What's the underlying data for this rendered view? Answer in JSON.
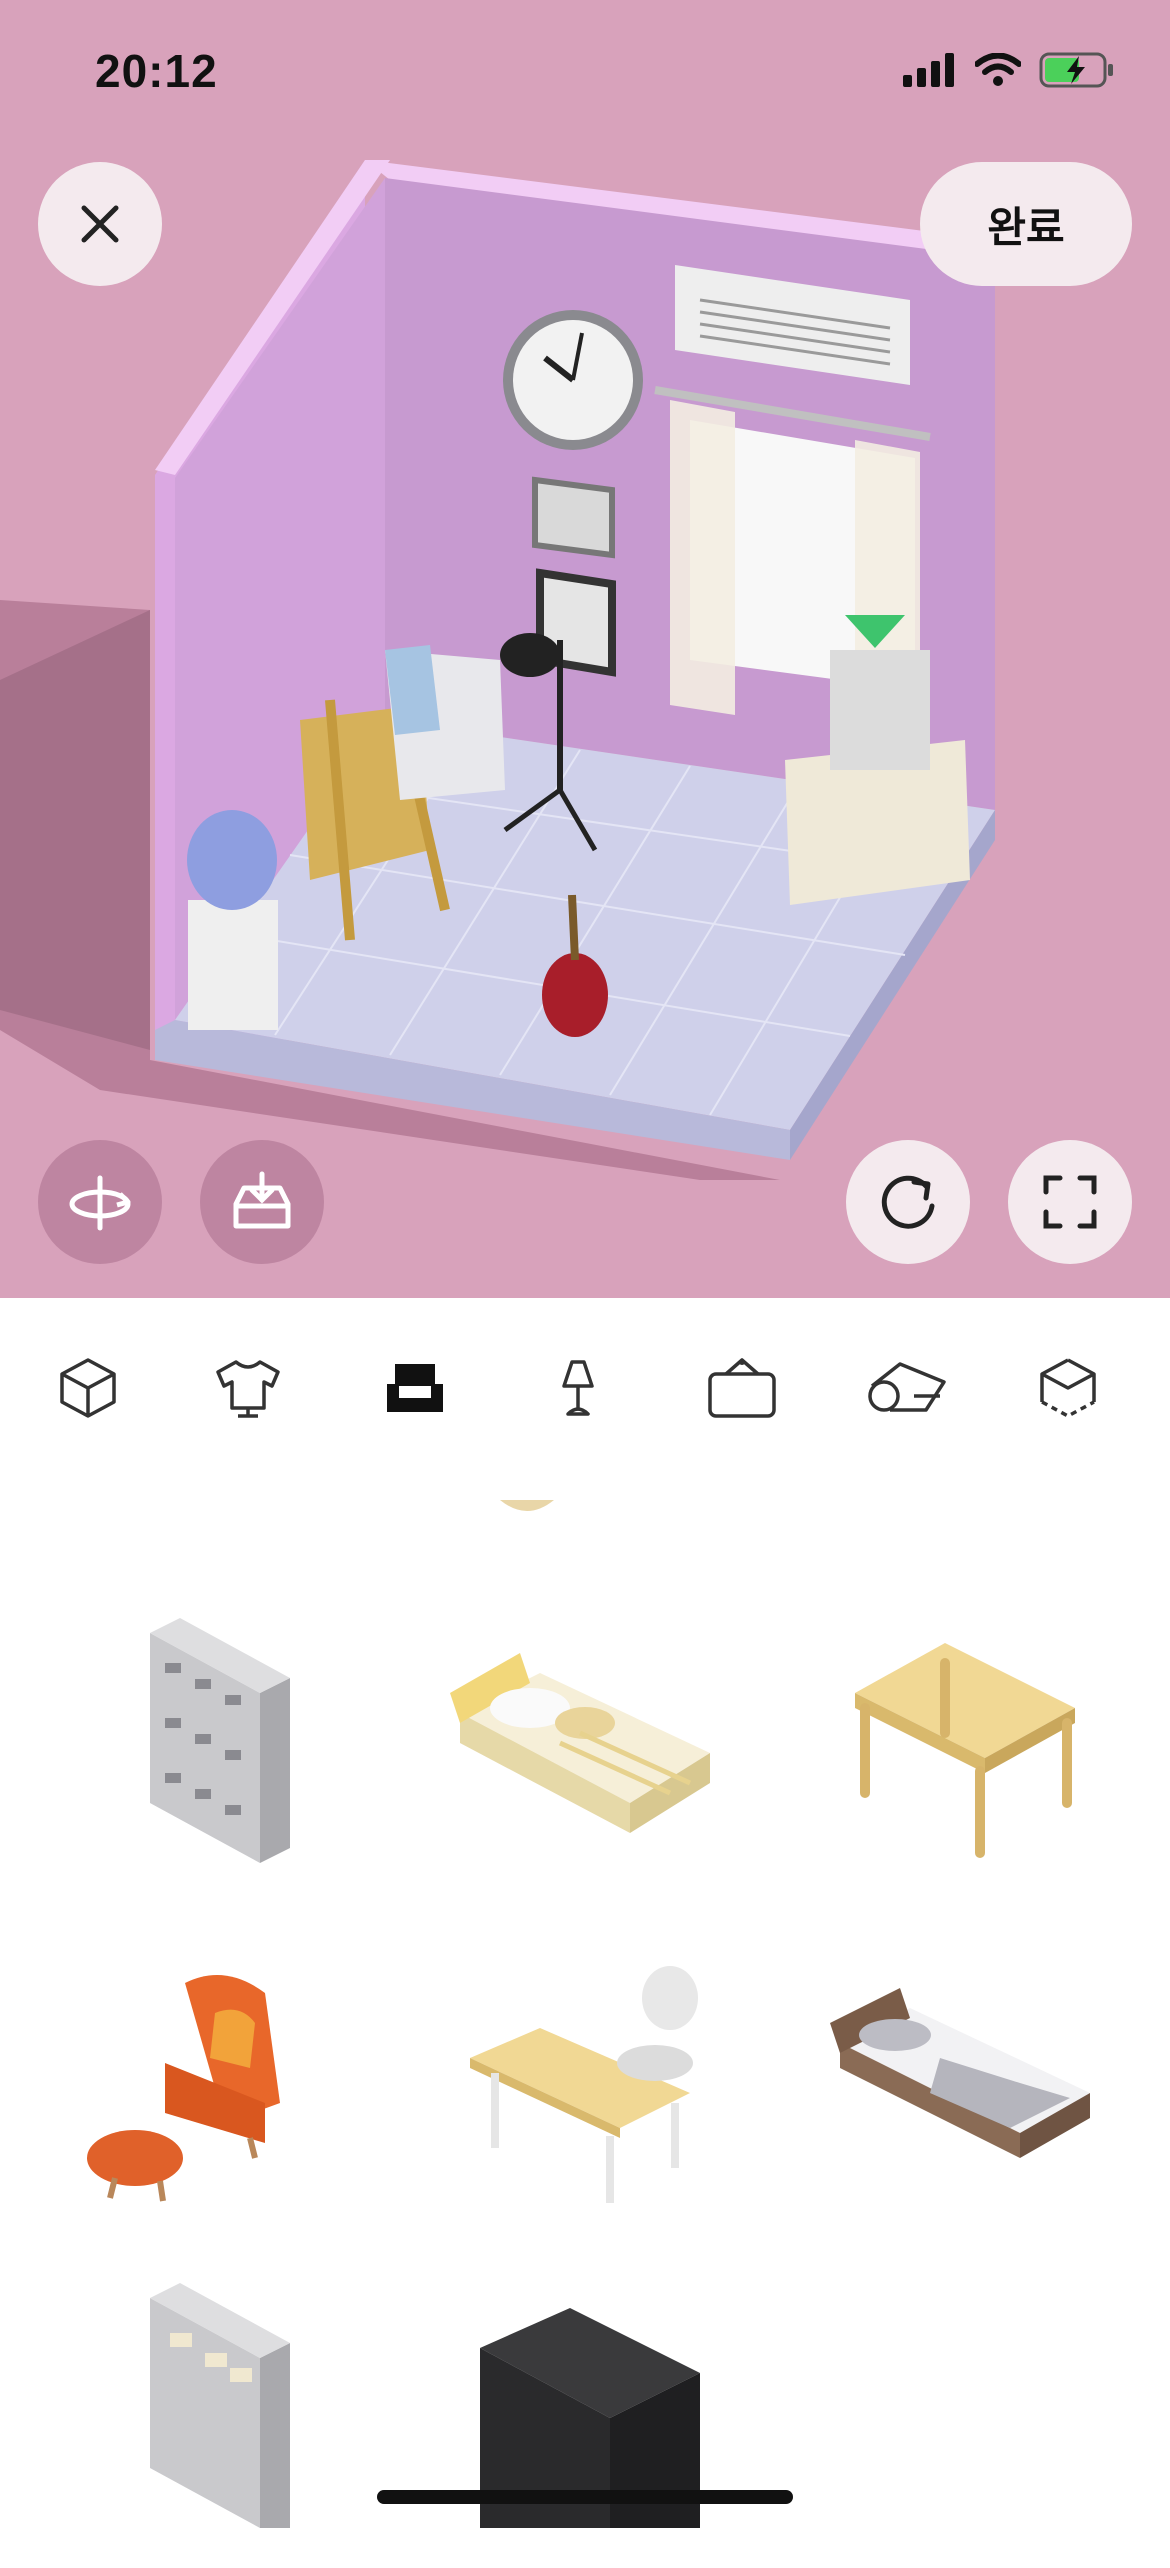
{
  "status_bar": {
    "time": "20:12"
  },
  "header": {
    "close_icon": "close-icon",
    "done_label": "완료"
  },
  "scene_controls": {
    "rotate_view_icon": "rotate-view-icon",
    "save_icon": "tray-download-icon",
    "reset_icon": "refresh-icon",
    "fullscreen_icon": "fullscreen-icon"
  },
  "colors": {
    "scene_background": "#d8a2bb",
    "wall": "#c99bd1",
    "floor": "#cfd0ea",
    "button_light": "#f4eaee",
    "selection_marker": "#3ec46d"
  },
  "categories": [
    {
      "icon": "cube-icon",
      "selected": false
    },
    {
      "icon": "shirt-icon",
      "selected": false
    },
    {
      "icon": "armchair-icon",
      "selected": true
    },
    {
      "icon": "lamp-icon",
      "selected": false
    },
    {
      "icon": "frame-icon",
      "selected": false
    },
    {
      "icon": "rug-roll-icon",
      "selected": false
    },
    {
      "icon": "room-outline-icon",
      "selected": false
    }
  ],
  "items": [
    {
      "name": "filing-cabinet"
    },
    {
      "name": "yellow-bed"
    },
    {
      "name": "wooden-table"
    },
    {
      "name": "orange-armchair-with-ottoman"
    },
    {
      "name": "desk-with-chair"
    },
    {
      "name": "gray-bed"
    },
    {
      "name": "shelf-cabinet"
    },
    {
      "name": "black-furniture"
    }
  ]
}
